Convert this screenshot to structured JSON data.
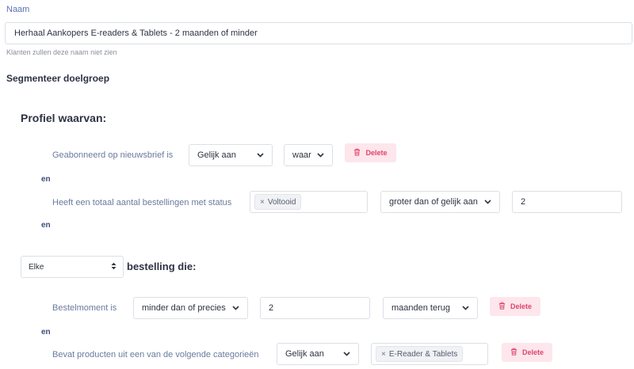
{
  "name_field": {
    "label": "Naam",
    "value": "Herhaal Aankopers E-readers & Tablets - 2 maanden of minder",
    "hint": "Klanten zullen deze naam niet zien"
  },
  "segment_title": "Segmenteer doelgroep",
  "profile_title": "Profiel waarvan:",
  "connector": "en",
  "profile_rows": [
    {
      "label": "Geabonneerd op nieuwsbrief is",
      "operator": "Gelijk aan",
      "value": "waar",
      "delete_label": "Delete"
    },
    {
      "label": "Heeft een totaal aantal bestellingen met status",
      "tag": "Voltooid",
      "operator": "groter dan of gelijk aan",
      "value": "2"
    }
  ],
  "order_scope": {
    "selected": "Elke",
    "suffix": "bestelling die:"
  },
  "order_rows": [
    {
      "label": "Bestelmoment is",
      "operator": "minder dan of precies",
      "value": "2",
      "unit": "maanden terug",
      "delete_label": "Delete"
    },
    {
      "label": "Bevat producten uit een van de volgende categorieën",
      "operator": "Gelijk aan",
      "tag": "E-Reader & Tablets",
      "delete_label": "Delete"
    }
  ],
  "icons": {
    "delete": "trash-icon",
    "tag_remove": "close-icon",
    "dropdown": "chevron-down-icon",
    "sort": "sort-arrows-icon"
  },
  "colors": {
    "label_blue": "#5b6fb5",
    "delete_bg": "#fde6ec",
    "delete_fg": "#e0436b"
  }
}
